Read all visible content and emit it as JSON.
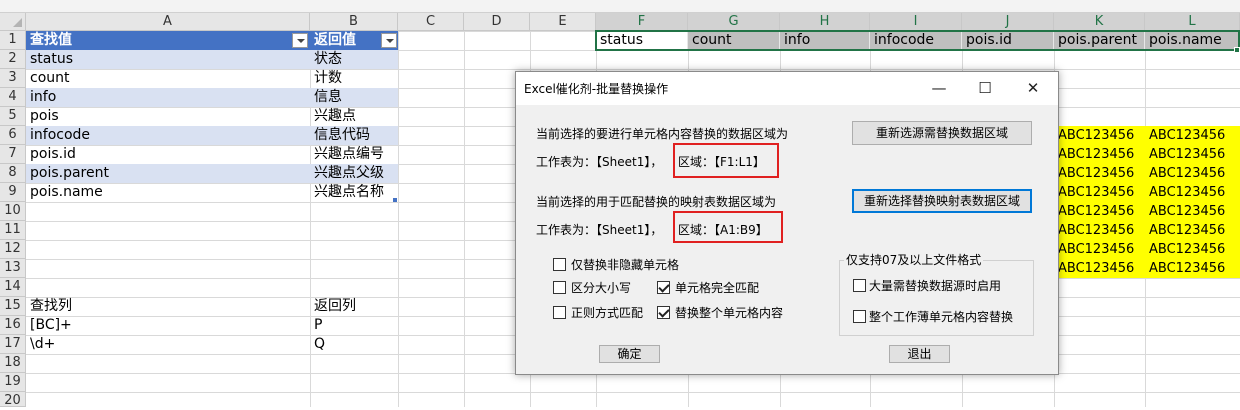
{
  "columns": [
    "A",
    "B",
    "C",
    "D",
    "E",
    "F",
    "G",
    "H",
    "I",
    "J",
    "K",
    "L"
  ],
  "rows": [
    "1",
    "2",
    "3",
    "4",
    "5",
    "6",
    "7",
    "8",
    "9",
    "10",
    "11",
    "12",
    "13",
    "14",
    "15",
    "16",
    "17",
    "18",
    "19",
    "20"
  ],
  "table": {
    "header_a": "查找值",
    "header_b": "返回值",
    "rows": [
      {
        "a": "status",
        "b": "状态"
      },
      {
        "a": "count",
        "b": "计数"
      },
      {
        "a": "info",
        "b": "信息"
      },
      {
        "a": "pois",
        "b": "兴趣点"
      },
      {
        "a": "infocode",
        "b": "信息代码"
      },
      {
        "a": "pois.id",
        "b": "兴趣点编号"
      },
      {
        "a": "pois.parent",
        "b": "兴趣点父级"
      },
      {
        "a": "pois.name",
        "b": "兴趣点名称"
      }
    ]
  },
  "regex_table": {
    "header_a": "查找列",
    "header_b": "返回列",
    "rows": [
      {
        "a": "[BC]+",
        "b": "P"
      },
      {
        "a": "\\d+",
        "b": "Q"
      }
    ]
  },
  "target_row": [
    "status",
    "count",
    "info",
    "infocode",
    "pois.id",
    "pois.parent",
    "pois.name"
  ],
  "yellow_value": "ABC123456",
  "dialog": {
    "title": "Excel催化剂-批量替换操作",
    "minimize": "—",
    "maximize": "☐",
    "close": "✕",
    "source_desc": "当前选择的要进行单元格内容替换的数据区域为",
    "source_sheet": "工作表为：【Sheet1】，",
    "source_range": "区域：【F1:L1】",
    "source_button": "重新选源需替换数据区域",
    "map_desc": "当前选择的用于匹配替换的映射表数据区域为",
    "map_sheet": "工作表为：【Sheet1】，",
    "map_range": "区域：【A1:B9】",
    "map_button": "重新选择替换映射表数据区域",
    "opt_nonhidden": "仅替换非隐藏单元格",
    "opt_case": "区分大小写",
    "opt_exact": "单元格完全匹配",
    "opt_regex": "正则方式匹配",
    "opt_whole": "替换整个单元格内容",
    "group_title": "仅支持07及以上文件格式",
    "opt_large": "大量需替换数据源时启用",
    "opt_workbook": "整个工作薄单元格内容替换",
    "ok": "确定",
    "exit": "退出"
  },
  "colors": {
    "header_blue": "#4472c4",
    "band_blue": "#d9e1f2",
    "yellow": "#ffff00",
    "red_box": "#e02020"
  }
}
